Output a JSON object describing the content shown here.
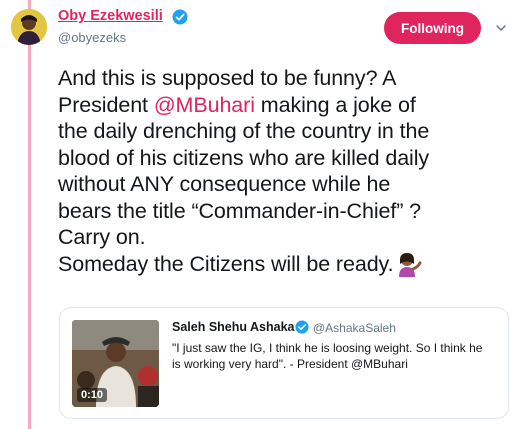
{
  "author": {
    "name": "Oby Ezekwesili",
    "handle": "@obyezeks",
    "verified": true,
    "avatar_icon": "avatar-photo"
  },
  "follow_button": {
    "label": "Following",
    "color": "#e0245e"
  },
  "menu_icon": "chevron-down-icon",
  "tweet": {
    "lines": [
      {
        "text": "And this is supposed to be funny? A"
      },
      {
        "prefix": "President ",
        "mention": "@MBuhari",
        "suffix": " making a joke of"
      },
      {
        "text": "the daily drenching of the country in the"
      },
      {
        "text": "blood of his citizens who are killed daily"
      },
      {
        "text": "without ANY consequence while he"
      },
      {
        "text": "bears the title “Commander-in-Chief” ?"
      },
      {
        "text": "Carry on."
      },
      {
        "text": "Someday the Citizens will be ready."
      }
    ],
    "emoji": "person-tipping-hand-emoji"
  },
  "quote": {
    "name": "Saleh Shehu Ashaka",
    "handle": "@AshakaSaleh",
    "verified": true,
    "lines": [
      "\"I just saw the IG, I think he is loosing weight. So I think he",
      "is working very hard\". - President @MBuhari"
    ],
    "video_duration": "0:10"
  },
  "colors": {
    "accent": "#e0245e",
    "thread_line": "#f4a9c0",
    "verified": "#1da1f2",
    "secondary_text": "#657786"
  }
}
